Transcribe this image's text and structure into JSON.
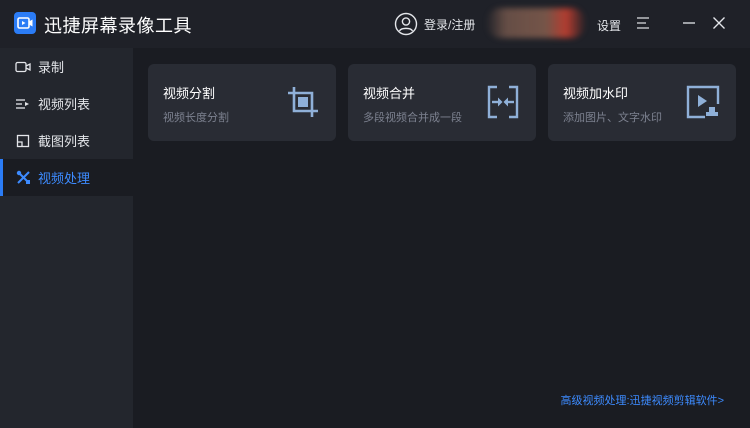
{
  "app": {
    "title": "迅捷屏幕录像工具"
  },
  "header": {
    "login_label": "登录/注册",
    "settings_label": "设置"
  },
  "sidebar": {
    "items": [
      {
        "label": "录制",
        "icon": "video-camera-icon",
        "active": false
      },
      {
        "label": "视频列表",
        "icon": "list-icon",
        "active": false
      },
      {
        "label": "截图列表",
        "icon": "screenshot-icon",
        "active": false
      },
      {
        "label": "视频处理",
        "icon": "tools-icon",
        "active": true
      }
    ]
  },
  "cards": [
    {
      "title": "视频分割",
      "desc": "视频长度分割",
      "icon": "crop-icon"
    },
    {
      "title": "视频合并",
      "desc": "多段视频合并成一段",
      "icon": "merge-icon"
    },
    {
      "title": "视频加水印",
      "desc": "添加图片、文字水印",
      "icon": "watermark-icon"
    }
  ],
  "footer": {
    "link": "高级视频处理:迅捷视频剪辑软件>"
  },
  "colors": {
    "accent": "#2b7cf6",
    "link": "#3d8bff",
    "background": "#1a1c22",
    "sidebar": "#23262d",
    "card": "#292c34"
  }
}
